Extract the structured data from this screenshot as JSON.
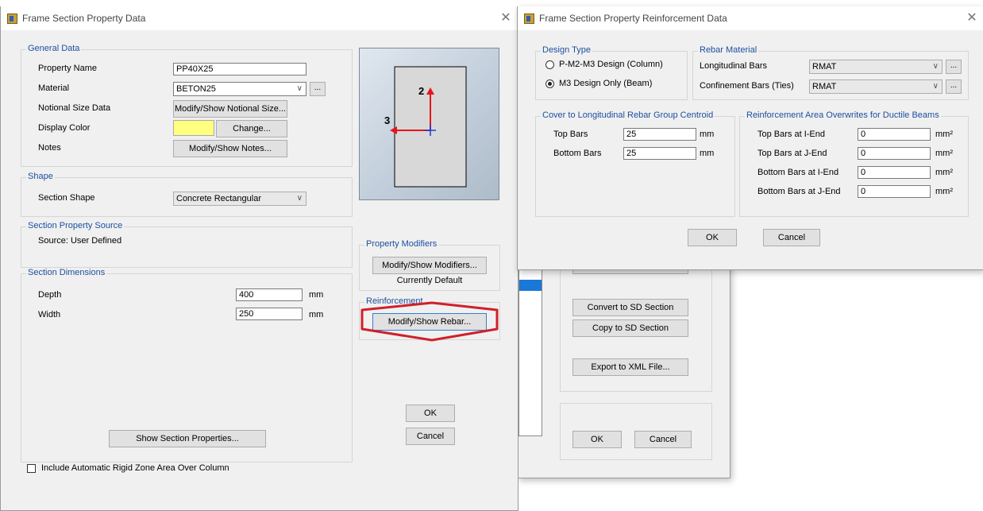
{
  "background_window": {
    "buttons": {
      "convert_sd": "Convert to SD Section",
      "copy_sd": "Copy to SD Section",
      "export_xml": "Export to XML File...",
      "ok": "OK",
      "cancel": "Cancel"
    }
  },
  "frame_dialog": {
    "title": "Frame Section Property Data",
    "general": {
      "legend": "General Data",
      "property_name_label": "Property Name",
      "property_name_value": "PP40X25",
      "material_label": "Material",
      "material_value": "BETON25",
      "notional_label": "Notional Size Data",
      "notional_button": "Modify/Show Notional Size...",
      "display_color_label": "Display Color",
      "display_color_value": "#ffff80",
      "change_button": "Change...",
      "notes_label": "Notes",
      "notes_button": "Modify/Show Notes..."
    },
    "shape": {
      "legend": "Shape",
      "section_shape_label": "Section Shape",
      "section_shape_value": "Concrete Rectangular"
    },
    "source": {
      "legend": "Section Property Source",
      "text": "Source:  User Defined"
    },
    "dimensions": {
      "legend": "Section Dimensions",
      "depth_label": "Depth",
      "depth_value": "400",
      "depth_unit": "mm",
      "width_label": "Width",
      "width_value": "250",
      "width_unit": "mm"
    },
    "preview": {
      "axis2": "2",
      "axis3": "3"
    },
    "modifiers": {
      "legend": "Property Modifiers",
      "button": "Modify/Show Modifiers...",
      "status": "Currently Default"
    },
    "reinforcement": {
      "legend": "Reinforcement",
      "button": "Modify/Show Rebar..."
    },
    "show_props_button": "Show Section Properties...",
    "ok": "OK",
    "cancel": "Cancel",
    "rigid_zone_label": "Include Automatic Rigid Zone Area Over Column",
    "rigid_zone_checked": false
  },
  "rebar_dialog": {
    "title": "Frame Section Property Reinforcement Data",
    "design_type": {
      "legend": "Design Type",
      "option1": "P-M2-M3 Design  (Column)",
      "option2": "M3 Design Only  (Beam)",
      "selected": "M3 Design Only  (Beam)"
    },
    "rebar_material": {
      "legend": "Rebar Material",
      "longitudinal_label": "Longitudinal Bars",
      "longitudinal_value": "RMAT",
      "confinement_label": "Confinement Bars (Ties)",
      "confinement_value": "RMAT"
    },
    "cover": {
      "legend": "Cover to Longitudinal Rebar Group Centroid",
      "top_label": "Top Bars",
      "top_value": "25",
      "top_unit": "mm",
      "bottom_label": "Bottom  Bars",
      "bottom_value": "25",
      "bottom_unit": "mm"
    },
    "overwrites": {
      "legend": "Reinforcement Area Overwrites for Ductile Beams",
      "rows": [
        {
          "label": "Top Bars at I-End",
          "value": "0",
          "unit": "mm²"
        },
        {
          "label": "Top Bars at J-End",
          "value": "0",
          "unit": "mm²"
        },
        {
          "label": "Bottom Bars at I-End",
          "value": "0",
          "unit": "mm²"
        },
        {
          "label": "Bottom Bars at J-End",
          "value": "0",
          "unit": "mm²"
        }
      ]
    },
    "ok": "OK",
    "cancel": "Cancel"
  },
  "colors": {
    "highlight_ring": "#d0202a",
    "axis_red": "#e8141c",
    "axis_blue": "#1e3cdc",
    "list_selection": "#1a78d8"
  }
}
